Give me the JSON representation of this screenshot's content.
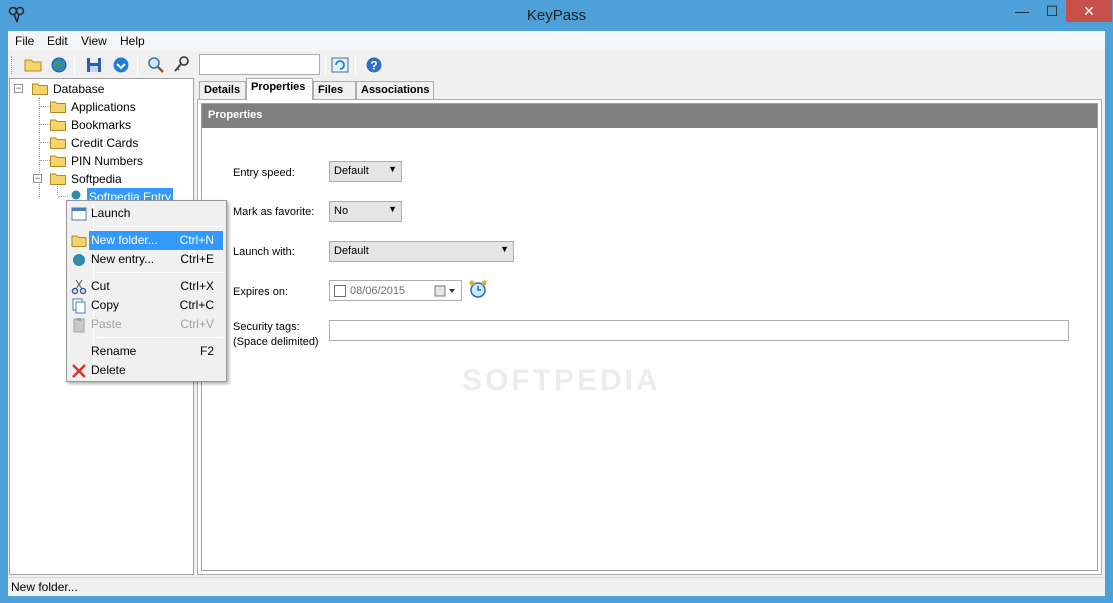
{
  "window": {
    "title": "KeyPass",
    "min": "—",
    "max": "☐",
    "close": "✕"
  },
  "menu": [
    "File",
    "Edit",
    "View",
    "Help"
  ],
  "toolbar": {
    "search_value": ""
  },
  "tree": {
    "root": "Database",
    "children": [
      "Applications",
      "Bookmarks",
      "Credit Cards",
      "PIN Numbers",
      "Softpedia"
    ],
    "selected_entry": "Softpedia Entry"
  },
  "tabs": [
    "Details",
    "Properties",
    "Files",
    "Associations"
  ],
  "properties": {
    "header": "Properties",
    "entry_speed_label": "Entry speed:",
    "entry_speed_value": "Default",
    "favorite_label": "Mark as favorite:",
    "favorite_value": "No",
    "launch_label": "Launch with:",
    "launch_value": "Default",
    "expires_label": "Expires on:",
    "expires_value": "08/06/2015",
    "security_label": "Security tags:",
    "security_sublabel": "(Space delimited)",
    "security_value": ""
  },
  "context_menu": {
    "items": [
      {
        "label": "Launch",
        "shortcut": ""
      },
      {
        "label": "New folder...",
        "shortcut": "Ctrl+N"
      },
      {
        "label": "New entry...",
        "shortcut": "Ctrl+E"
      },
      {
        "label": "Cut",
        "shortcut": "Ctrl+X"
      },
      {
        "label": "Copy",
        "shortcut": "Ctrl+C"
      },
      {
        "label": "Paste",
        "shortcut": "Ctrl+V"
      },
      {
        "label": "Rename",
        "shortcut": "F2"
      },
      {
        "label": "Delete",
        "shortcut": ""
      }
    ]
  },
  "status": {
    "text": "New folder..."
  },
  "watermark": "SOFTPEDIA",
  "colors": {
    "titlebar": "#4da0d8",
    "close": "#c7504a",
    "selection": "#3399ff",
    "header": "#808080"
  }
}
